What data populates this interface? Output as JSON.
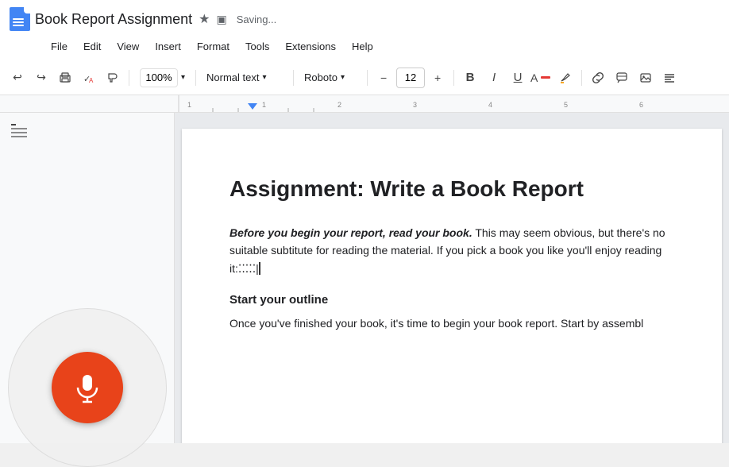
{
  "title_bar": {
    "doc_title": "Book Report Assignment",
    "star_icon": "★",
    "drive_icon": "▣",
    "saving_text": "Saving..."
  },
  "menu_bar": {
    "items": [
      {
        "label": "File",
        "id": "file"
      },
      {
        "label": "Edit",
        "id": "edit"
      },
      {
        "label": "View",
        "id": "view"
      },
      {
        "label": "Insert",
        "id": "insert"
      },
      {
        "label": "Format",
        "id": "format"
      },
      {
        "label": "Tools",
        "id": "tools"
      },
      {
        "label": "Extensions",
        "id": "extensions"
      },
      {
        "label": "Help",
        "id": "help"
      }
    ]
  },
  "toolbar": {
    "undo_label": "↩",
    "redo_label": "↪",
    "print_label": "🖨",
    "spell_label": "✓",
    "paint_label": "🖌",
    "zoom_value": "100%",
    "style_value": "Normal text",
    "font_value": "Roboto",
    "font_size_value": "12",
    "minus_label": "−",
    "plus_label": "+",
    "bold_label": "B",
    "italic_label": "I",
    "underline_label": "U",
    "text_color_label": "A",
    "highlight_label": "✏",
    "link_label": "🔗",
    "comment_label": "💬",
    "image_label": "🖼",
    "align_label": "≡"
  },
  "document": {
    "heading": "Assignment: Write a Book Report",
    "para1_bold": "Before you begin your report, read your book.",
    "para1_rest": " This may seem obvious, but there's no suitable subtitute for reading the material. If you pick a book you like you'll enjoy reading it:⁚⁚⁚⁚⁚|",
    "subheading": "Start your outline",
    "para2": "Once you've finished your book, it's time to begin your book report. Start by assembl"
  },
  "voice": {
    "mic_label": "🎤"
  },
  "sidebar": {
    "outline_icon": "☰"
  }
}
